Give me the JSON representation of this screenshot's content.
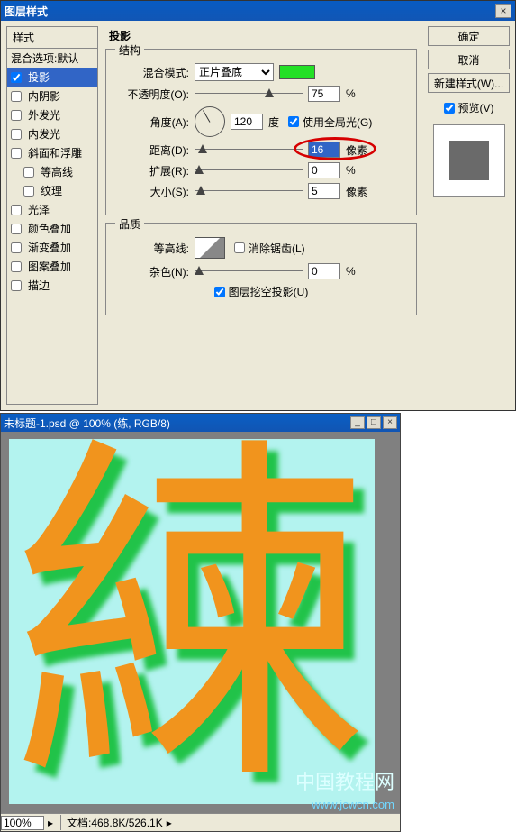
{
  "dialog": {
    "title": "图层样式",
    "styles_header": "样式",
    "blend_opts": "混合选项:默认",
    "list": [
      {
        "label": "投影",
        "checked": true,
        "selected": true
      },
      {
        "label": "内阴影",
        "checked": false
      },
      {
        "label": "外发光",
        "checked": false
      },
      {
        "label": "内发光",
        "checked": false
      },
      {
        "label": "斜面和浮雕",
        "checked": false
      },
      {
        "label": "等高线",
        "checked": false,
        "indent": true
      },
      {
        "label": "纹理",
        "checked": false,
        "indent": true
      },
      {
        "label": "光泽",
        "checked": false
      },
      {
        "label": "颜色叠加",
        "checked": false
      },
      {
        "label": "渐变叠加",
        "checked": false
      },
      {
        "label": "图案叠加",
        "checked": false
      },
      {
        "label": "描边",
        "checked": false
      }
    ]
  },
  "dropShadow": {
    "title": "投影",
    "structure_legend": "结构",
    "blend_mode_label": "混合模式:",
    "blend_mode_value": "正片叠底",
    "shadow_color": "#23e026",
    "opacity_label": "不透明度(O):",
    "opacity_value": "75",
    "opacity_unit": "%",
    "angle_label": "角度(A):",
    "angle_value": "120",
    "angle_unit": "度",
    "global_light_label": "使用全局光(G)",
    "global_light_checked": true,
    "distance_label": "距离(D):",
    "distance_value": "16",
    "distance_unit": "像素",
    "spread_label": "扩展(R):",
    "spread_value": "0",
    "spread_unit": "%",
    "size_label": "大小(S):",
    "size_value": "5",
    "size_unit": "像素",
    "quality_legend": "品质",
    "contour_label": "等高线:",
    "antialias_label": "消除锯齿(L)",
    "antialias_checked": false,
    "noise_label": "杂色(N):",
    "noise_value": "0",
    "noise_unit": "%",
    "knockout_label": "图层挖空投影(U)",
    "knockout_checked": true
  },
  "buttons": {
    "ok": "确定",
    "cancel": "取消",
    "new_style": "新建样式(W)...",
    "preview_label": "预览(V)",
    "preview_checked": true
  },
  "docwindow": {
    "title": "未标题-1.psd @ 100% (练, RGB/8)",
    "char": "練",
    "zoom": "100%",
    "status": "文档:468.8K/526.1K"
  },
  "watermark": {
    "line1": "中国教程网",
    "line2": "www.jcwcn.com"
  }
}
